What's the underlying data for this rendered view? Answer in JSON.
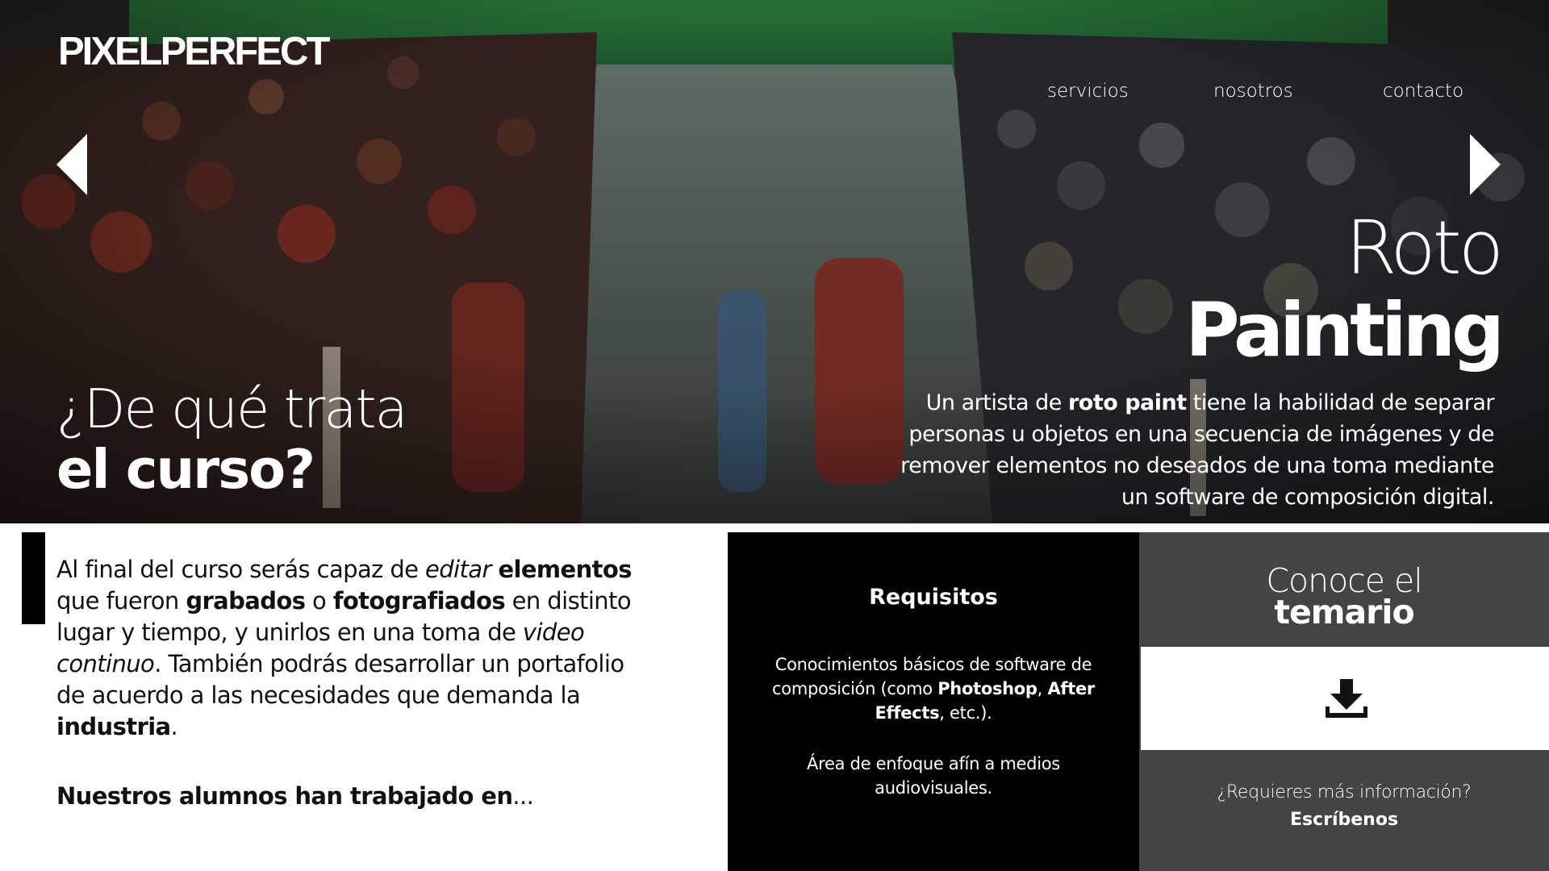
{
  "header": {
    "logo": "PIXELPERFECT",
    "nav": [
      {
        "label": "servicios"
      },
      {
        "label": "nosotros"
      },
      {
        "label": "contacto"
      }
    ]
  },
  "hero": {
    "title_line1": "Roto",
    "title_line2": "Painting",
    "desc_pre": "Un artista de ",
    "desc_bold": "roto paint",
    "desc_post": " tiene la habilidad de separar personas u objetos en una secuencia de imágenes y de remover elementos no deseados de una toma mediante un software de composición digital.",
    "course_line1": "¿De qué trata",
    "course_line2": "el curso?"
  },
  "about": {
    "t1": "Al final del curso serás capaz de ",
    "t2": "editar",
    "t3": "elementos",
    "t4": " que fueron ",
    "t5": "grabados",
    "t6": " o ",
    "t7": "fotografiados",
    "t8": " en distinto lugar y tiempo, y unirlos en una toma de ",
    "t9": "video continuo",
    "t10": ". También podrás desarrollar un portafolio de acuerdo a las necesidades que demanda la ",
    "t11": "industria",
    "t12": ".",
    "alumni_bold": "Nuestros alumnos han trabajado en",
    "alumni_rest": "..."
  },
  "requirements": {
    "title": "Requisitos",
    "p1_pre": "Conocimientos básicos de software de composición (como ",
    "p1_b1": "Photoshop",
    "p1_mid": ", ",
    "p1_b2": "After Effects",
    "p1_post": ", etc.).",
    "p2": "Área de enfoque afín a medios audiovisuales."
  },
  "syllabus": {
    "title_line1": "Conoce el",
    "title_line2": "temario",
    "download_icon": "download-icon",
    "question": "¿Requieres más información?",
    "contact_link": "Escríbenos"
  },
  "colors": {
    "hero_green": "#2f8a43",
    "panel_black": "#000000",
    "panel_gray": "#444444",
    "text_white": "#ffffff"
  }
}
